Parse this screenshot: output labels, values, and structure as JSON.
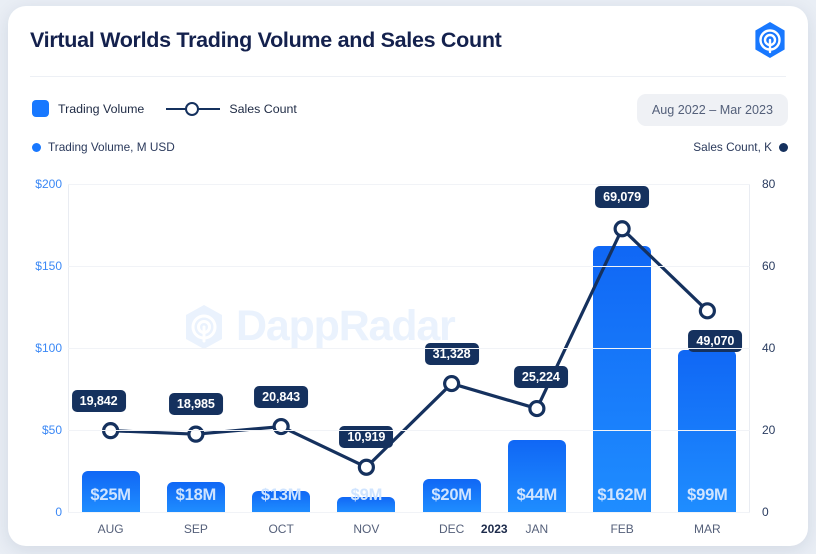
{
  "header": {
    "title": "Virtual Worlds Trading Volume and Sales Count",
    "logo_icon": "dappradar-logo-icon"
  },
  "legend": {
    "items": [
      {
        "label": "Trading Volume",
        "marker": "bar-swatch",
        "color": "#1878ff"
      },
      {
        "label": "Sales Count",
        "marker": "line-marker",
        "color": "#15315e"
      }
    ],
    "range_label": "Aug 2022 – Mar 2023"
  },
  "axis_captions": {
    "left": "Trading Volume, M USD",
    "right": "Sales Count, K"
  },
  "watermark": {
    "text": "DappRadar",
    "icon": "dappradar-watermark-icon"
  },
  "chart_data": {
    "type": "bar",
    "title": "Virtual Worlds Trading Volume and Sales Count",
    "subtitle": "Aug 2022 – Mar 2023",
    "xlabel": "",
    "ylabel": "Trading Volume, M USD",
    "y2label": "Sales Count, K",
    "categories": [
      "AUG",
      "SEP",
      "OCT",
      "NOV",
      "DEC",
      "JAN",
      "FEB",
      "MAR"
    ],
    "year_marker": {
      "label": "2023",
      "between": [
        "DEC",
        "JAN"
      ]
    },
    "grid": true,
    "legend_position": "top-left",
    "ylim": [
      0,
      200
    ],
    "yticks": [
      0,
      50,
      100,
      150,
      200
    ],
    "ytick_labels": [
      "0",
      "$50",
      "$100",
      "$150",
      "$200"
    ],
    "y2lim": [
      0,
      80
    ],
    "y2ticks": [
      0,
      20,
      40,
      60,
      80
    ],
    "y2tick_labels": [
      "0",
      "20",
      "40",
      "60",
      "80"
    ],
    "series": [
      {
        "name": "Trading Volume",
        "type": "bar",
        "axis": "left",
        "unit": "M USD",
        "color": "#1878ff",
        "values": [
          25,
          18,
          13,
          9,
          20,
          44,
          162,
          99
        ],
        "data_labels": [
          "$25M",
          "$18M",
          "$13M",
          "$9M",
          "$20M",
          "$44M",
          "$162M",
          "$99M"
        ]
      },
      {
        "name": "Sales Count",
        "type": "line",
        "axis": "right",
        "unit": "K",
        "color": "#15315e",
        "values": [
          19842,
          18985,
          20843,
          10919,
          31328,
          25224,
          69079,
          49070
        ],
        "values_k": [
          19.842,
          18.985,
          20.843,
          10.919,
          31.328,
          25.224,
          69.079,
          49.07
        ],
        "data_labels": [
          "19,842",
          "18,985",
          "20,843",
          "10,919",
          "31,328",
          "25,224",
          "69,079",
          "49,070"
        ]
      }
    ]
  }
}
